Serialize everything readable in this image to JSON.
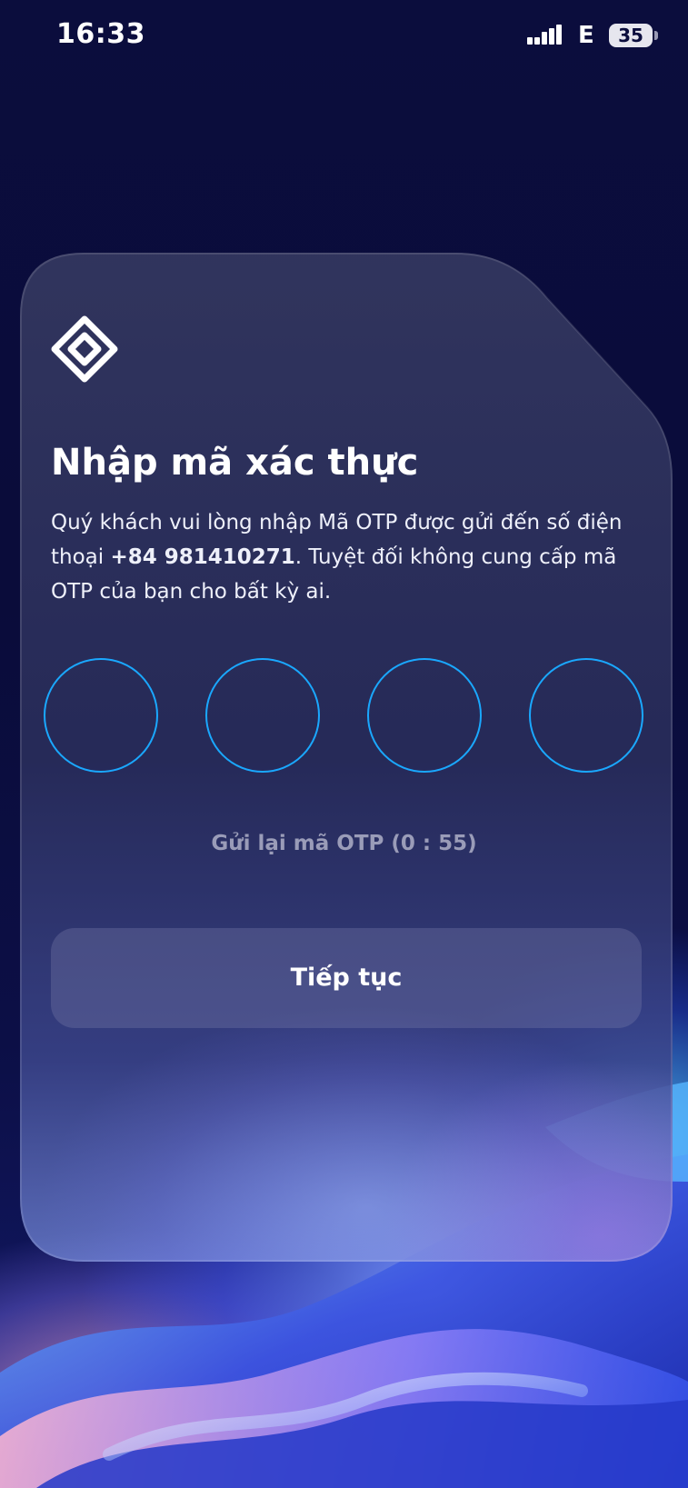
{
  "status_bar": {
    "time": "16:33",
    "network_type": "E",
    "battery_level": "35",
    "signal_icon": "signal-bars-icon"
  },
  "card": {
    "logo_icon": "diamond-logo-icon",
    "title": "Nhập mã xác thực",
    "description_before": "Quý khách vui lòng nhập Mã OTP được gửi đến số điện thoại ",
    "phone_number": "+84 981410271",
    "description_after": ". Tuyệt đối không cung cấp mã OTP của bạn cho bất kỳ ai.",
    "otp_digits": [
      "",
      "",
      "",
      ""
    ],
    "resend_text": "Gửi lại mã OTP (0 : 55)",
    "continue_label": "Tiếp tục"
  },
  "colors": {
    "background": "#0a0c38",
    "otp_border": "#1aa8ff",
    "resend_text": "#9a9cb8"
  }
}
